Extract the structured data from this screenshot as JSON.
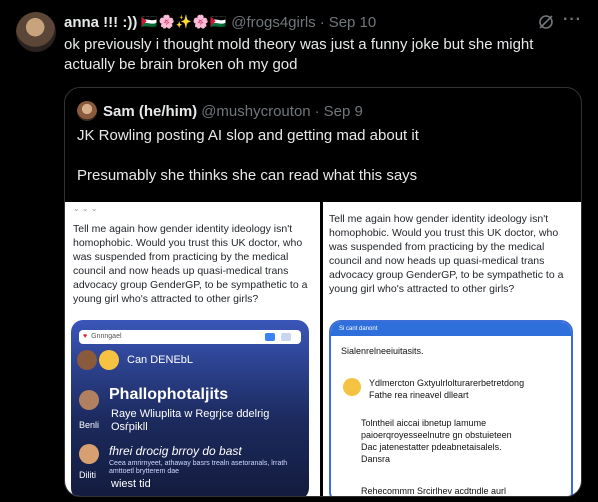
{
  "post": {
    "name": "anna !!! :))",
    "emoji": "🇵🇸🌸✨🌸🇵🇸",
    "handle": "@frogs4girls",
    "separator": "·",
    "date": "Sep 10",
    "more": "···",
    "text": "ok previously i thought mold theory was just a funny joke but she might actually be brain broken oh my god"
  },
  "quote": {
    "name": "Sam (he/him)",
    "handle": "@mushycrouton",
    "separator": "·",
    "date": "Sep 9",
    "line1": "JK Rowling posting AI slop and getting mad about it",
    "line2": "Presumably she thinks she can read what this says"
  },
  "image_left": {
    "tweet": "Tell me again how gender identity ideology isn't homophobic. Would you trust this UK doctor, who was suspended from practicing by the medical council and now heads up quasi-medical trans advocacy group GenderGP, to be sympathetic to a young girl who's attracted to other girls?",
    "search_text": "Gnnngael",
    "row_label": "Can DENEbL",
    "title": "Phallophotaljits",
    "subtitle": "Raye Wliuplita w Regrjce ddelrig Osŕpikll",
    "label1": "Benli",
    "line2": "fhrei drocig brroy do bast",
    "small": "Ceea amrirnyeet, athaway basrs trealn asetoranals, lrrath amttoetl brytterem dae",
    "label2": "Diliti",
    "last": "wiest tid"
  },
  "image_right": {
    "tweet": "Tell me again how gender identity ideology isn't homophobic. Would you trust this UK doctor, who was suspended from practicing by the medical council and now heads up quasi-medical trans advocacy group GenderGP, to be sympathetic to a young girl who's attracted to other girls?",
    "bar": "Si cant danont",
    "row": "Sialenrelneeiuitasits.",
    "line1": "Ydlmercton Gxtyulrlolturarerbetretdong",
    "line2": "Fathe rea rineavel dlleart",
    "line3": "Tolntheil aiccai ibnetup lamume",
    "line4": "paioerqroyesseelnutre gn obstuieteen",
    "line5": "Dac jatenestatter pdeabnetaisalels.",
    "line6": "Dansra",
    "line7": "Rehecommm Srcirlhev acdtndle aurl"
  }
}
